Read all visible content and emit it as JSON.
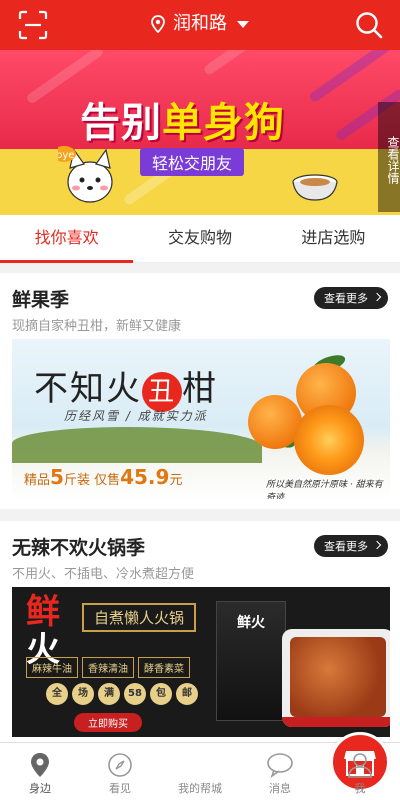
{
  "header": {
    "location": "润和路",
    "scan_icon": "scan-icon",
    "search_icon": "search-icon"
  },
  "banner": {
    "title_part1": "告别",
    "title_part2": "单身",
    "title_part3": "狗",
    "subtitle": "轻松交朋友",
    "side_label": "查看详情",
    "sticker": "bye"
  },
  "tabs": [
    {
      "label": "找你喜欢",
      "active": true
    },
    {
      "label": "交友购物",
      "active": false
    },
    {
      "label": "进店选购",
      "active": false
    }
  ],
  "sections": [
    {
      "title": "鲜果季",
      "subtitle": "现摘自家种丑柑，新鲜又健康",
      "more_label": "查看更多",
      "image": {
        "headline_a": "不知火",
        "headline_mark": "丑",
        "headline_b": "柑",
        "tagline": "历经风雪 / 成就实力派",
        "price_prefix": "精品",
        "price_qty": "5",
        "price_mid": "斤装 仅售",
        "price_value": "45.9",
        "price_unit": "元",
        "script": "所以美自然原汁原味 · 甜来有奇迹"
      }
    },
    {
      "title": "无辣不欢火锅季",
      "subtitle": "不用火、不插电、冷水煮超方便",
      "more_label": "查看更多",
      "image": {
        "brand_line1": "鲜",
        "brand_line2": "火",
        "slogan": "自煮懒人火锅",
        "pills": [
          "麻辣牛油",
          "香辣清油",
          "酵香素菜"
        ],
        "dots": [
          "全",
          "场",
          "满",
          "58",
          "包",
          "邮"
        ],
        "buy_label": "立即购买",
        "box_text": "鲜火"
      }
    }
  ],
  "bottom_nav": [
    {
      "label": "身边",
      "icon": "location-pin-icon",
      "active": true
    },
    {
      "label": "看见",
      "icon": "compass-icon",
      "active": false
    },
    {
      "label": "我的帮城",
      "icon": "store-icon",
      "active": false
    },
    {
      "label": "消息",
      "icon": "chat-bubble-icon",
      "active": false
    },
    {
      "label": "我",
      "icon": "user-icon",
      "active": false
    }
  ],
  "colors": {
    "accent": "#e8281f",
    "banner_purple": "#7a3bd6",
    "banner_yellow": "#f7d645"
  }
}
